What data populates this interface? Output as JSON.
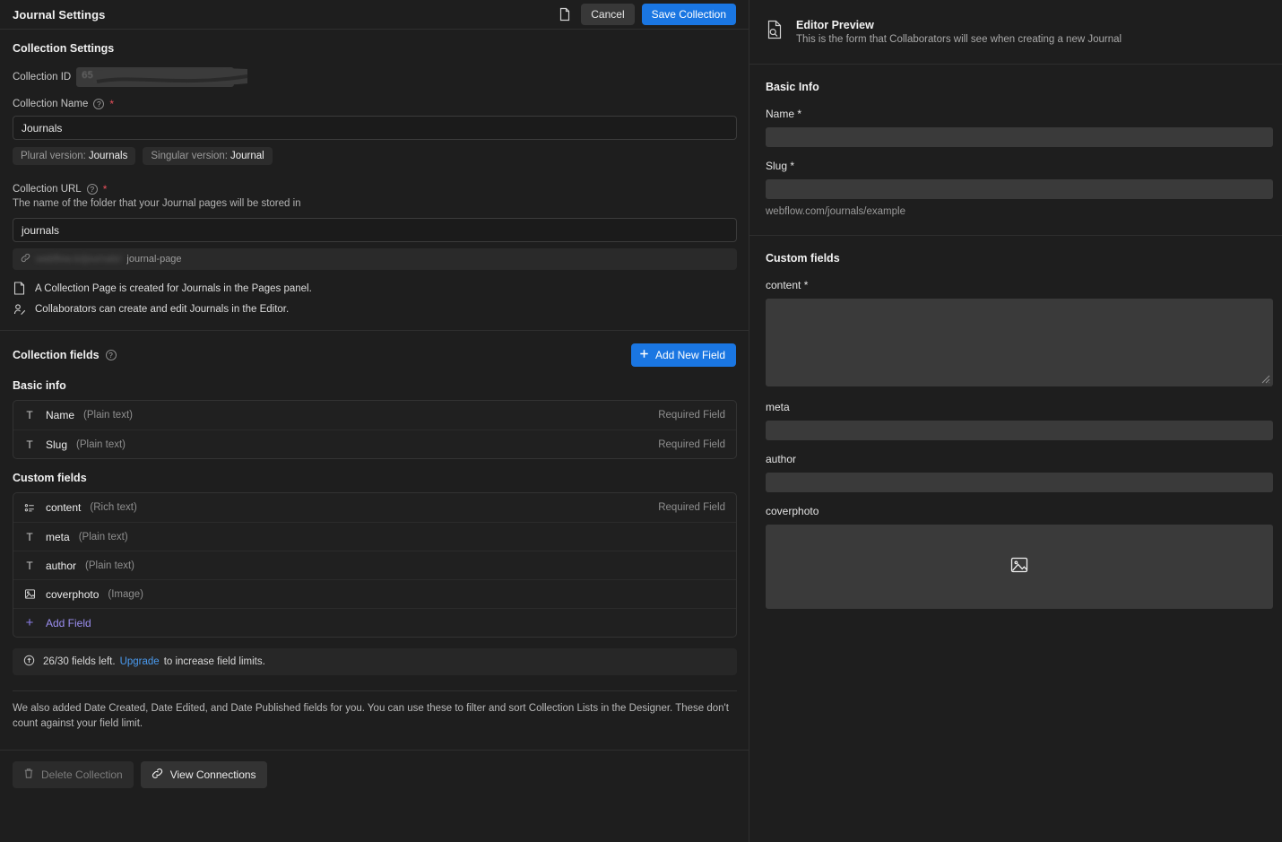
{
  "header": {
    "title": "Journal Settings",
    "duplicate_icon": "duplicate-icon",
    "cancel_label": "Cancel",
    "save_label": "Save Collection",
    "accent_color": "#1a76e2"
  },
  "collection_settings": {
    "section_title": "Collection Settings",
    "collection_id_label": "Collection ID",
    "collection_id_value": "652514a591ede",
    "collection_id_redacted": true,
    "name_label": "Collection Name",
    "name_help_icon": "question-icon",
    "name_required_marker": "*",
    "name_value": "Journals",
    "plural_pill_label": "Plural version:",
    "plural_pill_value": "Journals",
    "singular_pill_label": "Singular version:",
    "singular_pill_value": "Journal",
    "url_label": "Collection URL",
    "url_help_icon": "question-icon",
    "url_required_marker": "*",
    "url_description": "The name of the folder that your Journal pages will be stored in",
    "url_value": "journals",
    "url_preview_icon": "link-icon",
    "url_preview_blurred": "webflow.io/journals/",
    "url_preview_tail": "journal-page",
    "notes": [
      {
        "icon": "page-icon",
        "text": "A Collection Page is created for Journals in the Pages panel."
      },
      {
        "icon": "collaborator-icon",
        "text": "Collaborators can create and edit Journals in the Editor."
      }
    ]
  },
  "collection_fields": {
    "title": "Collection fields",
    "help_icon": "question-icon",
    "add_new_label": "Add New Field",
    "add_new_icon": "plus-icon",
    "groups": [
      {
        "label": "Basic info",
        "fields": [
          {
            "icon": "plain-text-icon",
            "icon_glyph": "T",
            "name": "Name",
            "type": "(Plain text)",
            "required": "Required Field"
          },
          {
            "icon": "plain-text-icon",
            "icon_glyph": "T",
            "name": "Slug",
            "type": "(Plain text)",
            "required": "Required Field"
          }
        ]
      },
      {
        "label": "Custom fields",
        "fields": [
          {
            "icon": "rich-text-icon",
            "icon_glyph": "",
            "name": "content",
            "type": "(Rich text)",
            "required": "Required Field"
          },
          {
            "icon": "plain-text-icon",
            "icon_glyph": "T",
            "name": "meta",
            "type": "(Plain text)",
            "required": ""
          },
          {
            "icon": "plain-text-icon",
            "icon_glyph": "T",
            "name": "author",
            "type": "(Plain text)",
            "required": ""
          },
          {
            "icon": "image-icon",
            "icon_glyph": "",
            "name": "coverphoto",
            "type": "(Image)",
            "required": ""
          }
        ],
        "add_field_label": "Add Field",
        "add_field_icon": "plus-icon"
      }
    ],
    "limit_icon": "info-arrow-icon",
    "limit_text_before": "26/30 fields left.",
    "limit_link": "Upgrade",
    "limit_text_after": "to increase field limits.",
    "footer_note": "We also added Date Created, Date Edited, and Date Published fields for you. You can use these to filter and sort Collection Lists in the Designer. These don't count against your field limit."
  },
  "bottom_bar": {
    "delete_icon": "trash-icon",
    "delete_label": "Delete Collection",
    "connections_icon": "link-icon",
    "connections_label": "View Connections"
  },
  "preview": {
    "icon": "document-search-icon",
    "title": "Editor Preview",
    "subtitle": "This is the form that Collaborators will see when creating a new Journal",
    "basic_info": {
      "title": "Basic Info",
      "fields": [
        {
          "label": "Name *",
          "value": "",
          "hint": ""
        },
        {
          "label": "Slug *",
          "value": "",
          "hint": "webflow.com/journals/example"
        }
      ]
    },
    "custom_fields": {
      "title": "Custom fields",
      "fields": [
        {
          "label": "content *",
          "kind": "textarea"
        },
        {
          "label": "meta",
          "kind": "input"
        },
        {
          "label": "author",
          "kind": "input"
        },
        {
          "label": "coverphoto",
          "kind": "image",
          "icon": "image-placeholder-icon"
        }
      ]
    }
  }
}
